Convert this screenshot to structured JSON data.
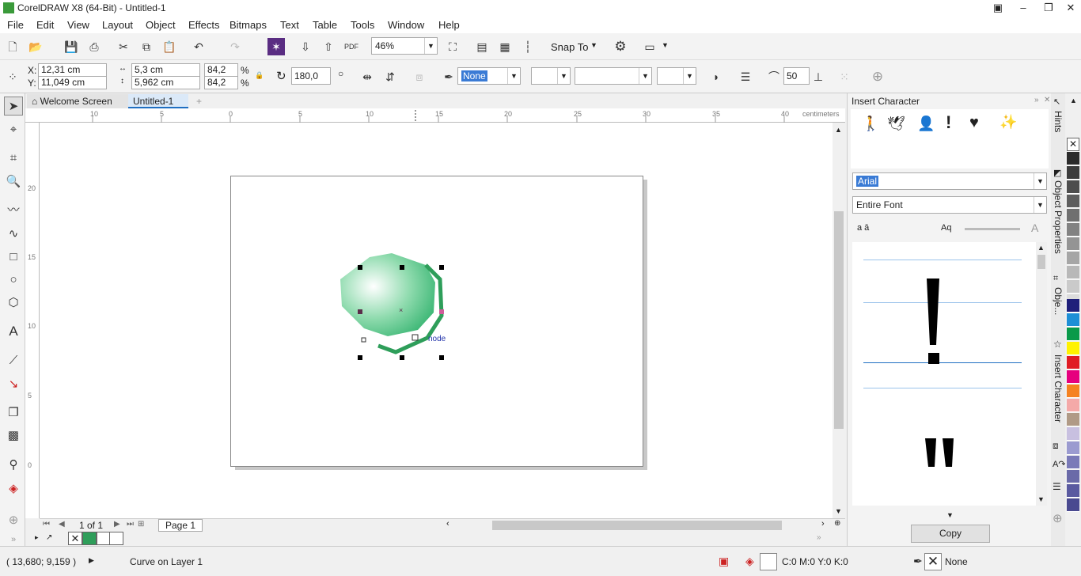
{
  "window": {
    "title": "CorelDRAW X8 (64-Bit) - Untitled-1"
  },
  "menu": [
    "File",
    "Edit",
    "View",
    "Layout",
    "Object",
    "Effects",
    "Bitmaps",
    "Text",
    "Table",
    "Tools",
    "Window",
    "Help"
  ],
  "toolbar": {
    "zoom": "46%",
    "snap_label": "Snap To"
  },
  "props": {
    "x_label": "X:",
    "x": "12,31 cm",
    "y_label": "Y:",
    "y": "11,049 cm",
    "w": "5,3 cm",
    "h": "5,962 cm",
    "sx": "84,2",
    "sy": "84,2",
    "pct": "%",
    "angle": "180,0",
    "outline": "None",
    "smooth": "50"
  },
  "tabs": {
    "welcome": "Welcome Screen",
    "doc": "Untitled-1"
  },
  "ruler": {
    "unit": "centimeters",
    "h_ticks": [
      "10",
      "5",
      "0",
      "5",
      "10",
      "15",
      "20",
      "25",
      "30",
      "35",
      "40"
    ],
    "v_ticks": [
      "20",
      "15",
      "10",
      "5",
      "0"
    ]
  },
  "canvas": {
    "node_label": "node"
  },
  "pagebar": {
    "page_of": "1  of  1",
    "page_tab": "Page 1"
  },
  "docker": {
    "title": "Insert Character",
    "font": "Arial",
    "subset": "Entire Font",
    "copy_button": "Copy"
  },
  "docker_tabs": {
    "hints": "Hints",
    "object_props": "Object Properties",
    "objects": "Obje...",
    "insert_char": "Insert Character"
  },
  "status": {
    "coords": "( 13,680; 9,159  )",
    "info": "Curve on Layer 1",
    "fill": "C:0 M:0 Y:0 K:0",
    "outline": "None"
  },
  "palette_colors": [
    "#ffffff",
    "#2b2b2b",
    "#3c3c3c",
    "#4d4d4d",
    "#5e5e5e",
    "#707070",
    "#828282",
    "#949494",
    "#a6a6a6",
    "#b8b8b8",
    "#cacaca",
    "#dcdcdc",
    "#ffffff",
    "#1f1f7a",
    "#1e8fd6",
    "#0a9a4a",
    "#fff200",
    "#e01b24",
    "#e6007e",
    "#f58220",
    "#f4a9a8",
    "#b09a86",
    "#c8c0e0",
    "#9b9bd0",
    "#7a7ab8",
    "#6a6aa8",
    "#5a5aa0",
    "#4a4a90"
  ],
  "colors": {
    "object_green": "#2e9e5a",
    "accent": "#1f6fc2"
  }
}
